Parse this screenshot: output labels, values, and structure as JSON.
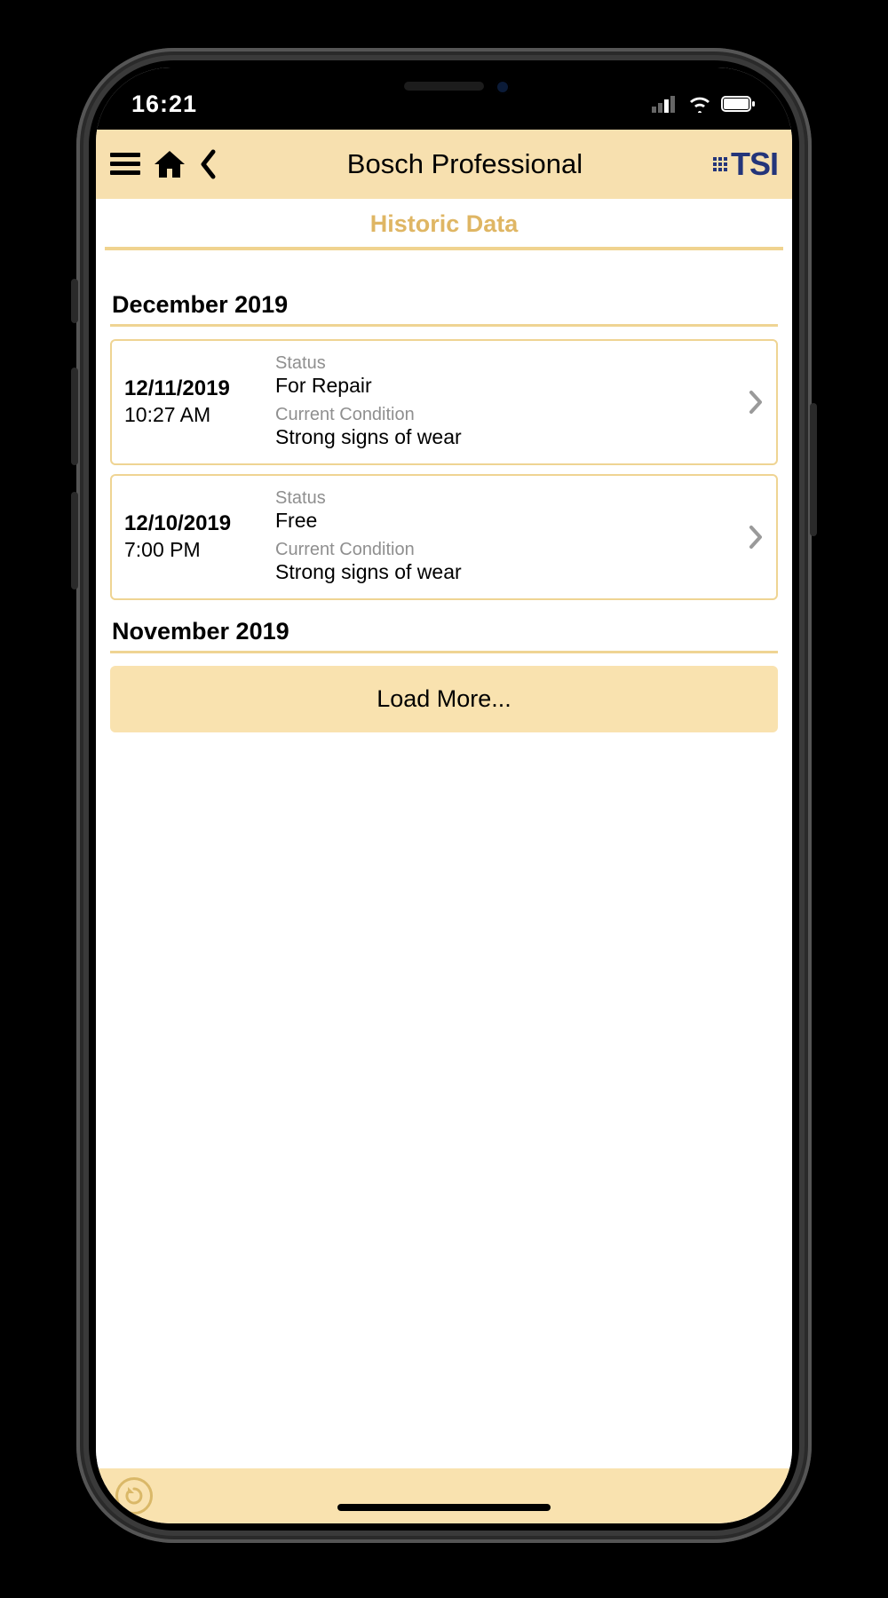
{
  "status_bar": {
    "time": "16:21"
  },
  "header": {
    "title": "Bosch Professional",
    "logo_text": "TSI"
  },
  "sub_header": {
    "title": "Historic Data"
  },
  "sections": [
    {
      "month": "December 2019",
      "entries": [
        {
          "date": "12/11/2019",
          "time": "10:27 AM",
          "status_label": "Status",
          "status_value": "For Repair",
          "condition_label": "Current Condition",
          "condition_value": "Strong signs of wear"
        },
        {
          "date": "12/10/2019",
          "time": "7:00 PM",
          "status_label": "Status",
          "status_value": "Free",
          "condition_label": "Current Condition",
          "condition_value": "Strong signs of wear"
        }
      ]
    },
    {
      "month": "November 2019",
      "entries": []
    }
  ],
  "load_more": {
    "label": "Load More..."
  }
}
